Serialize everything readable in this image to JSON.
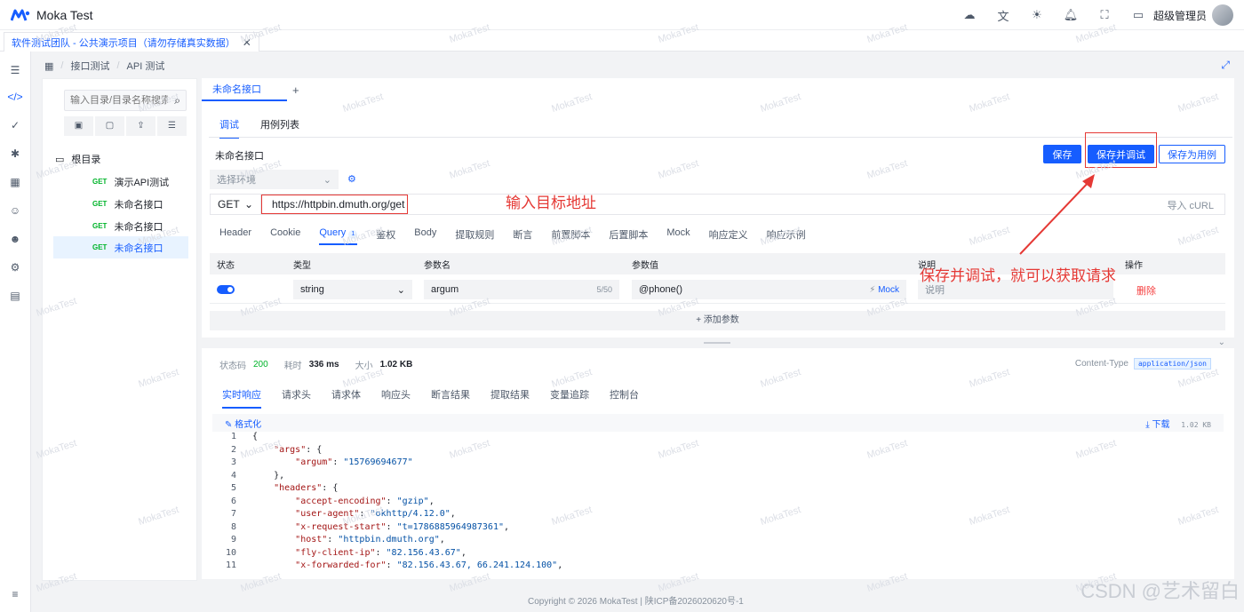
{
  "app": {
    "title": "Moka Test"
  },
  "topbar": {
    "user_name": "超级管理员"
  },
  "window_tabs": [
    {
      "label": "软件测试团队 - 公共演示项目（请勿存储真实数据）",
      "close": "✕"
    }
  ],
  "breadcrumb": [
    "接口测试",
    "API 测试"
  ],
  "tree": {
    "search_placeholder": "输入目录/目录名称搜索",
    "root": "根目录",
    "items": [
      {
        "method": "GET",
        "name": "演示API测试"
      },
      {
        "method": "GET",
        "name": "未命名接口"
      },
      {
        "method": "GET",
        "name": "未命名接口"
      },
      {
        "method": "GET",
        "name": "未命名接口"
      }
    ]
  },
  "editor": {
    "tab_label": "未命名接口",
    "add_tab": "+",
    "subtabs": [
      "调试",
      "用例列表"
    ],
    "interface_name": "未命名接口",
    "buttons": {
      "save": "保存",
      "save_debug": "保存并调试",
      "save_case": "保存为用例"
    },
    "env_placeholder": "选择环境",
    "method": "GET",
    "url": "https://httpbin.dmuth.org/get",
    "import_curl": "导入 cURL",
    "param_tabs": [
      "Header",
      "Cookie",
      "Query",
      "鉴权",
      "Body",
      "提取规则",
      "断言",
      "前置脚本",
      "后置脚本",
      "Mock",
      "响应定义",
      "响应示例"
    ],
    "query_count": "1",
    "table_headers": [
      "状态",
      "类型",
      "参数名",
      "参数值",
      "说明",
      "操作"
    ],
    "row": {
      "type": "string",
      "name": "argum",
      "name_count": "5/50",
      "value": "@phone()",
      "mock": "Mock",
      "desc_placeholder": "说明",
      "delete": "删除"
    },
    "add_param": "+ 添加参数"
  },
  "response": {
    "status_label": "状态码",
    "status": "200",
    "time_label": "耗时",
    "time": "336 ms",
    "size_label": "大小",
    "size": "1.02 KB",
    "content_type_label": "Content-Type",
    "content_type": "application/json",
    "tabs": [
      "实时响应",
      "请求头",
      "请求体",
      "响应头",
      "断言结果",
      "提取结果",
      "变量追踪",
      "控制台"
    ],
    "format": "格式化",
    "download": "下载",
    "body_size": "1.02 KB",
    "lines": [
      {
        "n": "1",
        "indent": "",
        "key": "",
        "val": "",
        "raw": "{"
      },
      {
        "n": "2",
        "indent": "    ",
        "key": "\"args\"",
        "val": "",
        "raw": ": {"
      },
      {
        "n": "3",
        "indent": "        ",
        "key": "\"argum\"",
        "val": "\"15769694677\"",
        "raw": ""
      },
      {
        "n": "4",
        "indent": "    ",
        "key": "",
        "val": "",
        "raw": "},"
      },
      {
        "n": "5",
        "indent": "    ",
        "key": "\"headers\"",
        "val": "",
        "raw": ": {"
      },
      {
        "n": "6",
        "indent": "        ",
        "key": "\"accept-encoding\"",
        "val": "\"gzip\"",
        "raw": ","
      },
      {
        "n": "7",
        "indent": "        ",
        "key": "\"user-agent\"",
        "val": "\"okhttp/4.12.0\"",
        "raw": ","
      },
      {
        "n": "8",
        "indent": "        ",
        "key": "\"x-request-start\"",
        "val": "\"t=1786885964987361\"",
        "raw": ","
      },
      {
        "n": "9",
        "indent": "        ",
        "key": "\"host\"",
        "val": "\"httpbin.dmuth.org\"",
        "raw": ","
      },
      {
        "n": "10",
        "indent": "        ",
        "key": "\"fly-client-ip\"",
        "val": "\"82.156.43.67\"",
        "raw": ","
      },
      {
        "n": "11",
        "indent": "        ",
        "key": "\"x-forwarded-for\"",
        "val": "\"82.156.43.67, 66.241.124.100\"",
        "raw": ","
      }
    ]
  },
  "footer": {
    "text": "Copyright © 2026 MokaTest | 陕ICP备2026020620号-1"
  },
  "annotations": {
    "url_hint": "输入目标地址",
    "save_hint": "保存并调试，就可以获取请求"
  },
  "watermark": "MokaTest",
  "overlay": "CSDN @艺术留白",
  "colors": {
    "primary": "#165dff",
    "annotation": "#e53935",
    "get": "#00b42a"
  }
}
